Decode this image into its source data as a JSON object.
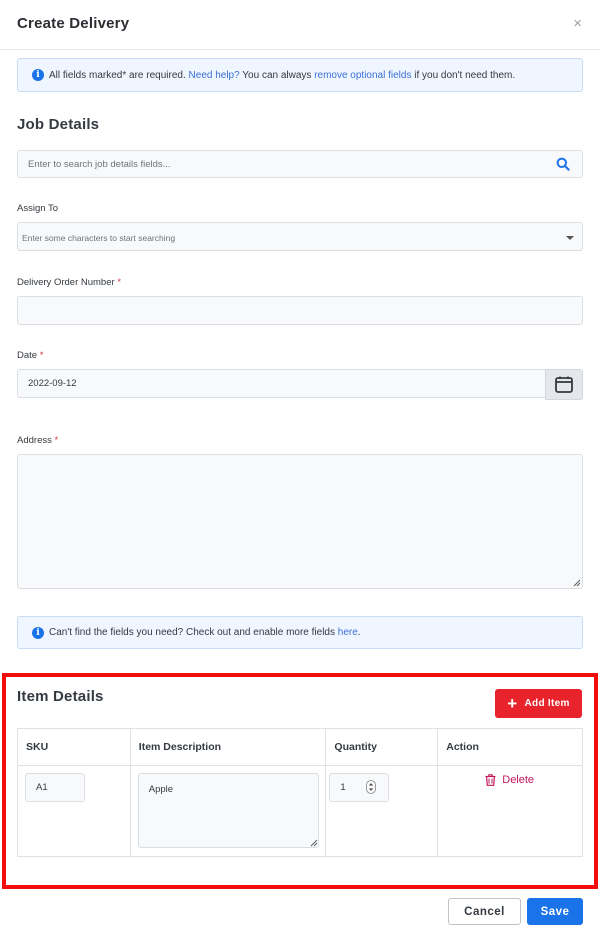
{
  "modal": {
    "title": "Create Delivery",
    "close_glyph": "×"
  },
  "info_top": {
    "icon": "info-icon",
    "text_1": "All fields marked ",
    "asterisk": "*",
    "text_2": " are required. ",
    "link_help": "Need help?",
    "text_3": " You can always ",
    "link_remove": "remove optional fields",
    "text_4": " if you don't need them."
  },
  "job_details": {
    "title": "Job Details",
    "search": {
      "placeholder": "Enter to search job details fields...",
      "value": "",
      "icon": "search-icon"
    },
    "assign_to": {
      "label": "Assign To",
      "placeholder": "Enter some characters to start searching"
    },
    "delivery_order_number": {
      "label": "Delivery Order Number",
      "required_mark": "*",
      "value": ""
    },
    "date": {
      "label": "Date",
      "required_mark": "*",
      "value": "2022-09-12",
      "icon": "calendar-icon"
    },
    "address": {
      "label": "Address",
      "required_mark": "*",
      "value": ""
    }
  },
  "info_bottom": {
    "icon": "info-icon",
    "text": "Can't find the fields you need? Check out and enable more fields ",
    "link": "here",
    "suffix": "."
  },
  "item_details": {
    "title": "Item Details",
    "add_button": "Add Item",
    "add_icon": "plus-icon",
    "columns": [
      "SKU",
      "Item Description",
      "Quantity",
      "Action"
    ],
    "rows": [
      {
        "sku": "A1",
        "description": "Apple",
        "quantity": "1",
        "action": "Delete",
        "action_icon": "trash-icon"
      }
    ]
  },
  "footer": {
    "cancel": "Cancel",
    "save": "Save"
  },
  "colors": {
    "primary": "#1a73e8",
    "danger": "#e8232b",
    "highlight_border": "#f20c0c",
    "delete_text": "#c2185b"
  }
}
